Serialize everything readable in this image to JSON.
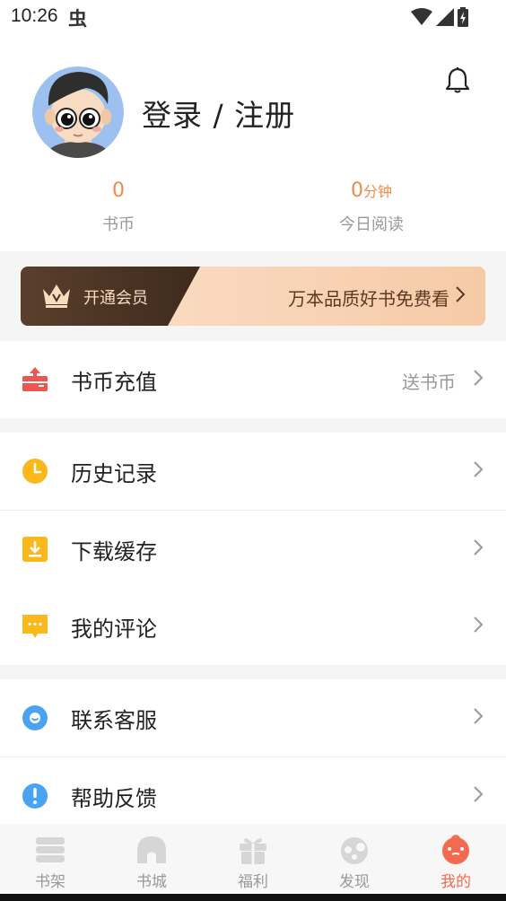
{
  "status_bar": {
    "time": "10:26",
    "bug_glyph": "虫"
  },
  "profile": {
    "login_text": "登录 / 注册",
    "coins": {
      "value": "0",
      "label": "书币"
    },
    "reading": {
      "value": "0",
      "unit": "分钟",
      "label": "今日阅读"
    }
  },
  "vip": {
    "open_label": "开通会员",
    "slogan": "万本品质好书免费看"
  },
  "menu": {
    "recharge": {
      "label": "书币充值",
      "extra": "送书币",
      "icon": "recharge-icon"
    },
    "history": {
      "label": "历史记录",
      "icon": "clock-icon"
    },
    "download": {
      "label": "下载缓存",
      "icon": "download-icon"
    },
    "comments": {
      "label": "我的评论",
      "icon": "comment-icon"
    },
    "service": {
      "label": "联系客服",
      "icon": "service-icon"
    },
    "feedback": {
      "label": "帮助反馈",
      "icon": "help-icon"
    }
  },
  "tabs": {
    "shelf": "书架",
    "store": "书城",
    "welfare": "福利",
    "discover": "发现",
    "mine": "我的"
  },
  "colors": {
    "accent": "#f08a4b",
    "active_tab": "#f46a4f",
    "recharge": "#f0564f",
    "history": "#fbb81c",
    "service": "#4aa3f0"
  }
}
